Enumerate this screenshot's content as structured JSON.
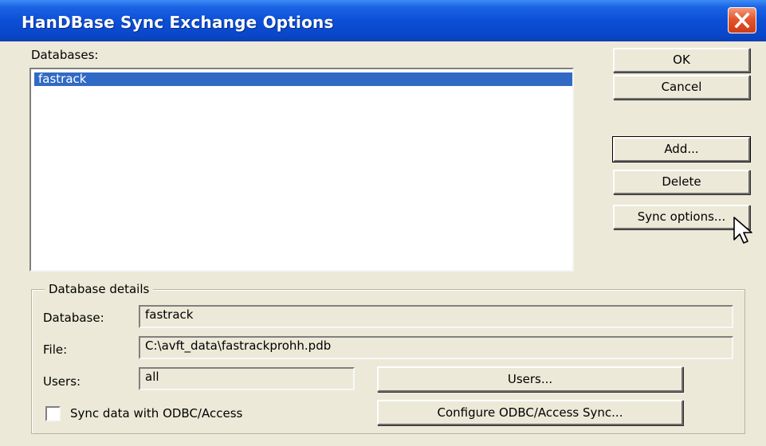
{
  "window": {
    "title": "HanDBase Sync Exchange Options"
  },
  "databases": {
    "label": "Databases:",
    "items": [
      {
        "label": "fastrack",
        "selected": true
      }
    ]
  },
  "buttons": {
    "ok": "OK",
    "cancel": "Cancel",
    "add": "Add...",
    "delete": "Delete",
    "sync_options": "Sync options..."
  },
  "details": {
    "group_label": "Database details",
    "database_label": "Database:",
    "database_value": "fastrack",
    "file_label": "File:",
    "file_value": "C:\\avft_data\\fastrackprohh.pdb",
    "users_label": "Users:",
    "users_value": "all",
    "users_button": "Users...",
    "sync_checkbox_label": "Sync data with ODBC/Access",
    "sync_checkbox_checked": false,
    "configure_button": "Configure ODBC/Access Sync..."
  },
  "colors": {
    "titlebar": "#0a46c8",
    "selection": "#316ac5",
    "dialog_bg": "#ece9d8",
    "close_button": "#e4562e"
  },
  "icons": {
    "close": "close-x-icon",
    "cursor": "mouse-pointer-icon"
  }
}
